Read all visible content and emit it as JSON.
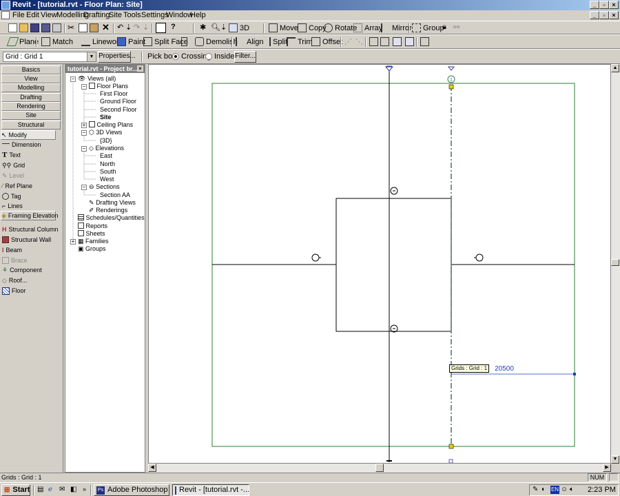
{
  "window": {
    "title": "Revit - [tutorial.rvt - Floor Plan: Site]"
  },
  "menu": [
    "File",
    "Edit",
    "View",
    "Modelling",
    "Drafting",
    "Site",
    "Tools",
    "Settings",
    "Window",
    "Help"
  ],
  "toolbar1": {
    "move": "Move",
    "copy": "Copy",
    "rotate": "Rotate",
    "array": "Array",
    "mirror": "Mirror",
    "group": "Group",
    "three_d": "3D"
  },
  "toolbar2": {
    "plane": "Plane",
    "match": "Match",
    "linework": "Linework",
    "paint": "Paint",
    "split_face": "Split Face",
    "demolish": "Demolish",
    "align": "Align",
    "split": "Split",
    "trim": "Trim",
    "offset": "Offset"
  },
  "options_bar": {
    "type_selector": "Grid : Grid 1",
    "properties": "Properties...",
    "pick_box_label": "Pick box:",
    "crossing": "Crossing",
    "inside": "Inside",
    "pick_mode": "Crossing",
    "filter": "Filter..."
  },
  "design_bar": {
    "tabs": [
      "Basics",
      "View",
      "Modelling",
      "Drafting",
      "Rendering",
      "Site",
      "Structural"
    ],
    "tools": [
      {
        "label": "Modify",
        "enabled": true,
        "icon": "arrow-icon"
      },
      {
        "label": "Dimension",
        "enabled": true,
        "icon": "dimension-icon"
      },
      {
        "label": "Text",
        "enabled": true,
        "icon": "text-icon"
      },
      {
        "label": "Grid",
        "enabled": true,
        "icon": "grid-icon"
      },
      {
        "label": "Level",
        "enabled": false,
        "icon": "level-icon"
      },
      {
        "label": "Ref Plane",
        "enabled": true,
        "icon": "ref-plane-icon"
      },
      {
        "label": "Tag",
        "enabled": true,
        "icon": "tag-icon"
      },
      {
        "label": "Lines",
        "enabled": true,
        "icon": "lines-icon"
      },
      {
        "label": "Framing Elevation",
        "enabled": true,
        "icon": "framing-elevation-icon"
      },
      {
        "label": "Structural Column",
        "enabled": true,
        "icon": "column-icon"
      },
      {
        "label": "Structural Wall",
        "enabled": true,
        "icon": "wall-icon"
      },
      {
        "label": "Beam",
        "enabled": true,
        "icon": "beam-icon"
      },
      {
        "label": "Brace",
        "enabled": false,
        "icon": "brace-icon"
      },
      {
        "label": "Component",
        "enabled": true,
        "icon": "component-icon"
      },
      {
        "label": "Roof...",
        "enabled": true,
        "icon": "roof-icon"
      },
      {
        "label": "Floor",
        "enabled": true,
        "icon": "floor-icon"
      }
    ]
  },
  "project_browser": {
    "title": "tutorial.rvt - Project br...",
    "views_all": "Views (all)",
    "floor_plans": "Floor Plans",
    "first_floor": "First Floor",
    "ground_floor": "Ground Floor",
    "second_floor": "Second Floor",
    "site": "Site",
    "ceiling_plans": "Ceiling Plans",
    "views_3d": "3D Views",
    "view_3d": "{3D}",
    "elevations": "Elevations",
    "east": "East",
    "north": "North",
    "south": "South",
    "west": "West",
    "sections": "Sections",
    "section_aa": "Section AA",
    "drafting_views": "Drafting Views",
    "renderings": "Renderings",
    "schedules": "Schedules/Quantities",
    "reports": "Reports",
    "sheets": "Sheets",
    "families": "Families",
    "groups": "Groups"
  },
  "canvas": {
    "grid_bubble": "1",
    "tooltip": "Grids : Grid : 1",
    "dimension": "20500"
  },
  "status_bar": {
    "text": "Grids : Grid : 1",
    "num": "NUM"
  },
  "taskbar": {
    "start": "Start",
    "tasks": [
      "Adobe Photoshop",
      "Revit - [tutorial.rvt -..."
    ],
    "lang": "EN",
    "clock": "2:23 PM"
  },
  "colors": {
    "title_gradient_start": "#0a246a",
    "title_gradient_end": "#a6caf0",
    "site_boundary": "#2e7d32",
    "selected_grid": "#3a7a5a",
    "dimension_text": "#1f3fbf",
    "highlight_grip": "#e8d000"
  }
}
